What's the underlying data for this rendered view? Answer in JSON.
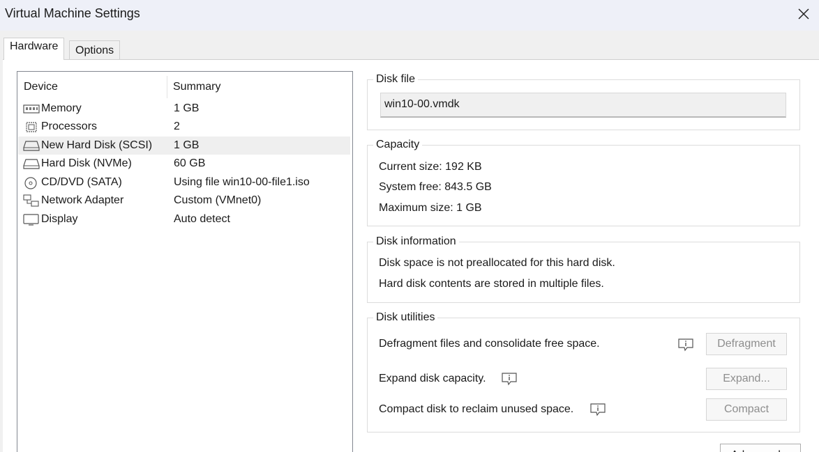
{
  "window": {
    "title": "Virtual Machine Settings",
    "close_icon": "close-icon"
  },
  "tabs": [
    {
      "label": "Hardware",
      "active": true
    },
    {
      "label": "Options",
      "active": false
    }
  ],
  "device_list": {
    "columns": [
      "Device",
      "Summary"
    ],
    "rows": [
      {
        "icon": "memory-icon",
        "name": "Memory",
        "summary": "1 GB"
      },
      {
        "icon": "processor-icon",
        "name": "Processors",
        "summary": "2"
      },
      {
        "icon": "hard-disk-icon",
        "name": "New Hard Disk (SCSI)",
        "summary": "1 GB",
        "selected": true
      },
      {
        "icon": "hard-disk-icon",
        "name": "Hard Disk (NVMe)",
        "summary": "60 GB"
      },
      {
        "icon": "cd-dvd-icon",
        "name": "CD/DVD (SATA)",
        "summary": "Using file win10-00-file1.iso"
      },
      {
        "icon": "network-adapter-icon",
        "name": "Network Adapter",
        "summary": "Custom (VMnet0)"
      },
      {
        "icon": "display-icon",
        "name": "Display",
        "summary": "Auto detect"
      }
    ]
  },
  "disk_file": {
    "legend": "Disk file",
    "value": "win10-00.vmdk"
  },
  "capacity": {
    "legend": "Capacity",
    "current_size": "Current size:  192 KB",
    "system_free": "System free:  843.5 GB",
    "maximum_size": "Maximum size:  1 GB"
  },
  "disk_information": {
    "legend": "Disk information",
    "line1": "Disk space is not preallocated for this hard disk.",
    "line2": "Hard disk contents are stored in multiple files."
  },
  "disk_utilities": {
    "legend": "Disk utilities",
    "defragment_text": "Defragment files and consolidate free space.",
    "defragment_button": "Defragment",
    "expand_text": "Expand disk capacity.",
    "expand_button": "Expand...",
    "compact_text": "Compact disk to reclaim unused space.",
    "compact_button": "Compact",
    "info_icon": "info-icon"
  },
  "advanced_button": "Advanced..."
}
